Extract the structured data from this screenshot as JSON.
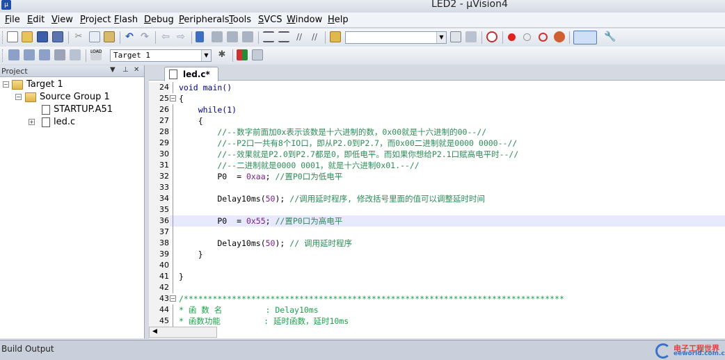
{
  "window": {
    "title": "LED2  - µVision4"
  },
  "menu": [
    "File",
    "Edit",
    "View",
    "Project",
    "Flash",
    "Debug",
    "Peripherals",
    "Tools",
    "SVCS",
    "Window",
    "Help"
  ],
  "toolbar2": {
    "target_select": "Target 1"
  },
  "project_panel": {
    "title": "Project",
    "tree": [
      {
        "label": "Target 1",
        "level": 0,
        "expander": "−"
      },
      {
        "label": "Source Group 1",
        "level": 1,
        "expander": "−"
      },
      {
        "label": "STARTUP.A51",
        "level": 2,
        "expander": ""
      },
      {
        "label": "led.c",
        "level": 2,
        "expander": "+"
      }
    ]
  },
  "editor": {
    "tab_label": "led.c*",
    "lines": [
      {
        "n": "24",
        "text": "void main()",
        "style": "kw"
      },
      {
        "n": "25",
        "text": "{",
        "fold": "−"
      },
      {
        "n": "26",
        "text": "    while(1)",
        "style": "kw"
      },
      {
        "n": "27",
        "text": "    {"
      },
      {
        "n": "28",
        "text": "        //--数字前面加0x表示该数是十六进制的数，0x00就是十六进制的00--//",
        "style": "cm"
      },
      {
        "n": "29",
        "text": "        //--P2口一共有8个IO口，即从P2.0到P2.7，而0x00二进制就是0000 0000--//",
        "style": "cm"
      },
      {
        "n": "30",
        "text": "        //--效果就是P2.0到P2.7都是0，即低电平。而如果你想给P2.1口赋高电平时--//",
        "style": "cm"
      },
      {
        "n": "31",
        "text": "        //--二进制就是0000 0001，就是十六进制0x01.--//",
        "style": "cm"
      },
      {
        "n": "32",
        "code": "        P0  = ",
        "num": "0xaa",
        "rest": "; ",
        "comment": "//置P0口为低电平"
      },
      {
        "n": "33",
        "text": ""
      },
      {
        "n": "34",
        "code": "        Delay10ms(",
        "num": "50",
        "rest": "); ",
        "comment": "//调用延时程序, 修改括号里面的值可以调整延时时间"
      },
      {
        "n": "35",
        "text": ""
      },
      {
        "n": "36",
        "code": "        P0  = ",
        "num": "0x55",
        "rest": "; ",
        "comment": "//置P0口为高电平",
        "current": true
      },
      {
        "n": "37",
        "text": ""
      },
      {
        "n": "38",
        "code": "        Delay10ms(",
        "num": "50",
        "rest": "); ",
        "comment": "// 调用延时程序"
      },
      {
        "n": "39",
        "text": "    }"
      },
      {
        "n": "40",
        "text": ""
      },
      {
        "n": "41",
        "text": "}"
      },
      {
        "n": "42",
        "text": ""
      },
      {
        "n": "43",
        "text": "/*******************************************************************************",
        "style": "cm2",
        "fold": "−"
      },
      {
        "n": "44",
        "text": "* 函 数 名         : Delay10ms",
        "style": "cm2"
      },
      {
        "n": "45",
        "text": "* 函数功能         : 延时函数，延时10ms",
        "style": "cm2"
      }
    ]
  },
  "bottom": {
    "title": "Build Output"
  },
  "watermark": {
    "line1": "电子工程世界",
    "line2": "eeworld.com.cn"
  }
}
